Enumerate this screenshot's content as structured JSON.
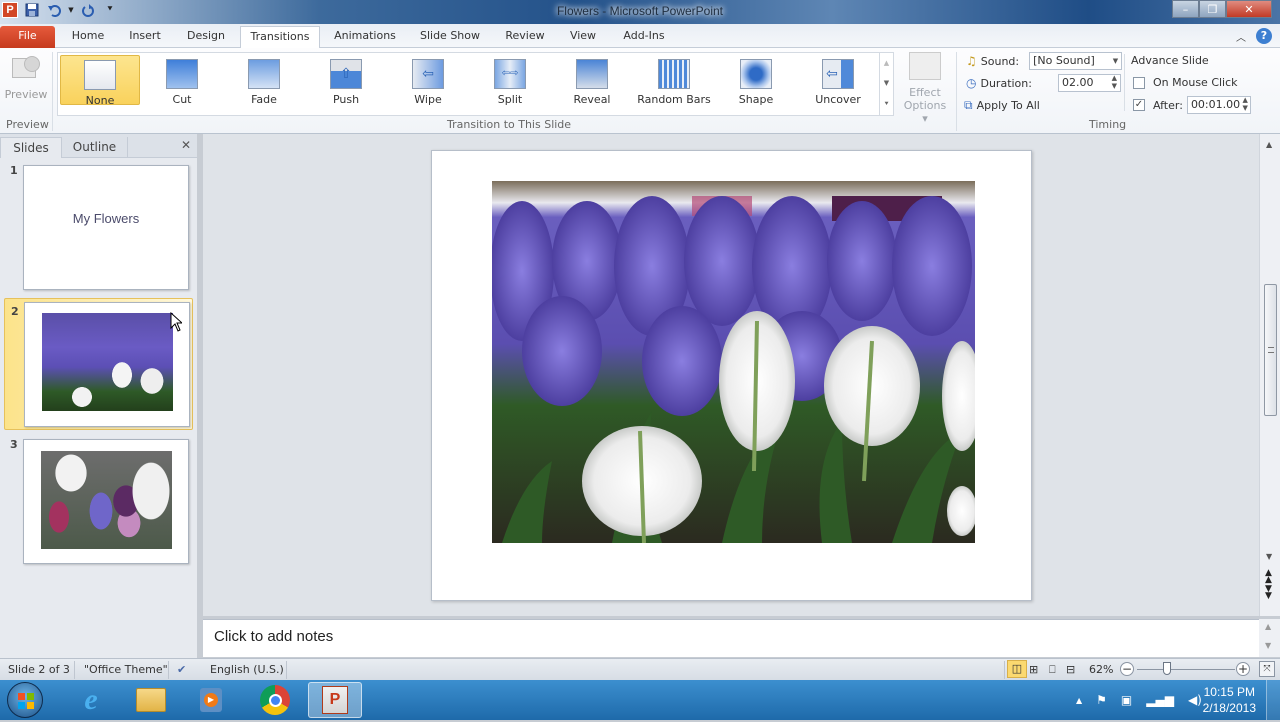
{
  "window": {
    "title": "Flowers  -  Microsoft PowerPoint",
    "app_icon": "P",
    "controls": {
      "minimize": "–",
      "restore": "❐",
      "close": "✕"
    }
  },
  "qat": {
    "save": "save-icon",
    "undo": "undo-icon",
    "redo": "redo-icon",
    "customize": "customize-icon"
  },
  "tabs": [
    {
      "label": "File"
    },
    {
      "label": "Home"
    },
    {
      "label": "Insert"
    },
    {
      "label": "Design"
    },
    {
      "label": "Transitions"
    },
    {
      "label": "Animations"
    },
    {
      "label": "Slide Show"
    },
    {
      "label": "Review"
    },
    {
      "label": "View"
    },
    {
      "label": "Add-Ins"
    }
  ],
  "ribbon": {
    "preview": {
      "button_label": "Preview",
      "group_label": "Preview"
    },
    "transitions": {
      "group_label": "Transition to This Slide",
      "items": [
        {
          "label": "None",
          "selected": true
        },
        {
          "label": "Cut"
        },
        {
          "label": "Fade"
        },
        {
          "label": "Push"
        },
        {
          "label": "Wipe"
        },
        {
          "label": "Split"
        },
        {
          "label": "Reveal"
        },
        {
          "label": "Random Bars"
        },
        {
          "label": "Shape"
        },
        {
          "label": "Uncover"
        }
      ],
      "effect_options_line1": "Effect",
      "effect_options_line2": "Options"
    },
    "timing": {
      "group_label": "Timing",
      "sound_label": "Sound:",
      "sound_value": "[No Sound]",
      "duration_label": "Duration:",
      "duration_value": "02.00",
      "apply_all_label": "Apply To All",
      "advance_label": "Advance Slide",
      "on_mouse_click_label": "On Mouse Click",
      "on_mouse_click_checked": false,
      "after_label": "After:",
      "after_checked": true,
      "after_value": "00:01.00"
    }
  },
  "slides_pane": {
    "tab_slides": "Slides",
    "tab_outline": "Outline",
    "close": "✕",
    "slides": [
      {
        "number": "1",
        "title": "My Flowers"
      },
      {
        "number": "2",
        "selected": true
      },
      {
        "number": "3"
      }
    ]
  },
  "notes": {
    "placeholder": "Click to add notes"
  },
  "status": {
    "slide_info": "Slide 2 of 3",
    "theme": "\"Office Theme\"",
    "language": "English (U.S.)",
    "zoom": "62%",
    "zoom_fraction": 0.62
  },
  "taskbar": {
    "clock_time": "10:15 PM",
    "clock_date": "2/18/2013"
  }
}
